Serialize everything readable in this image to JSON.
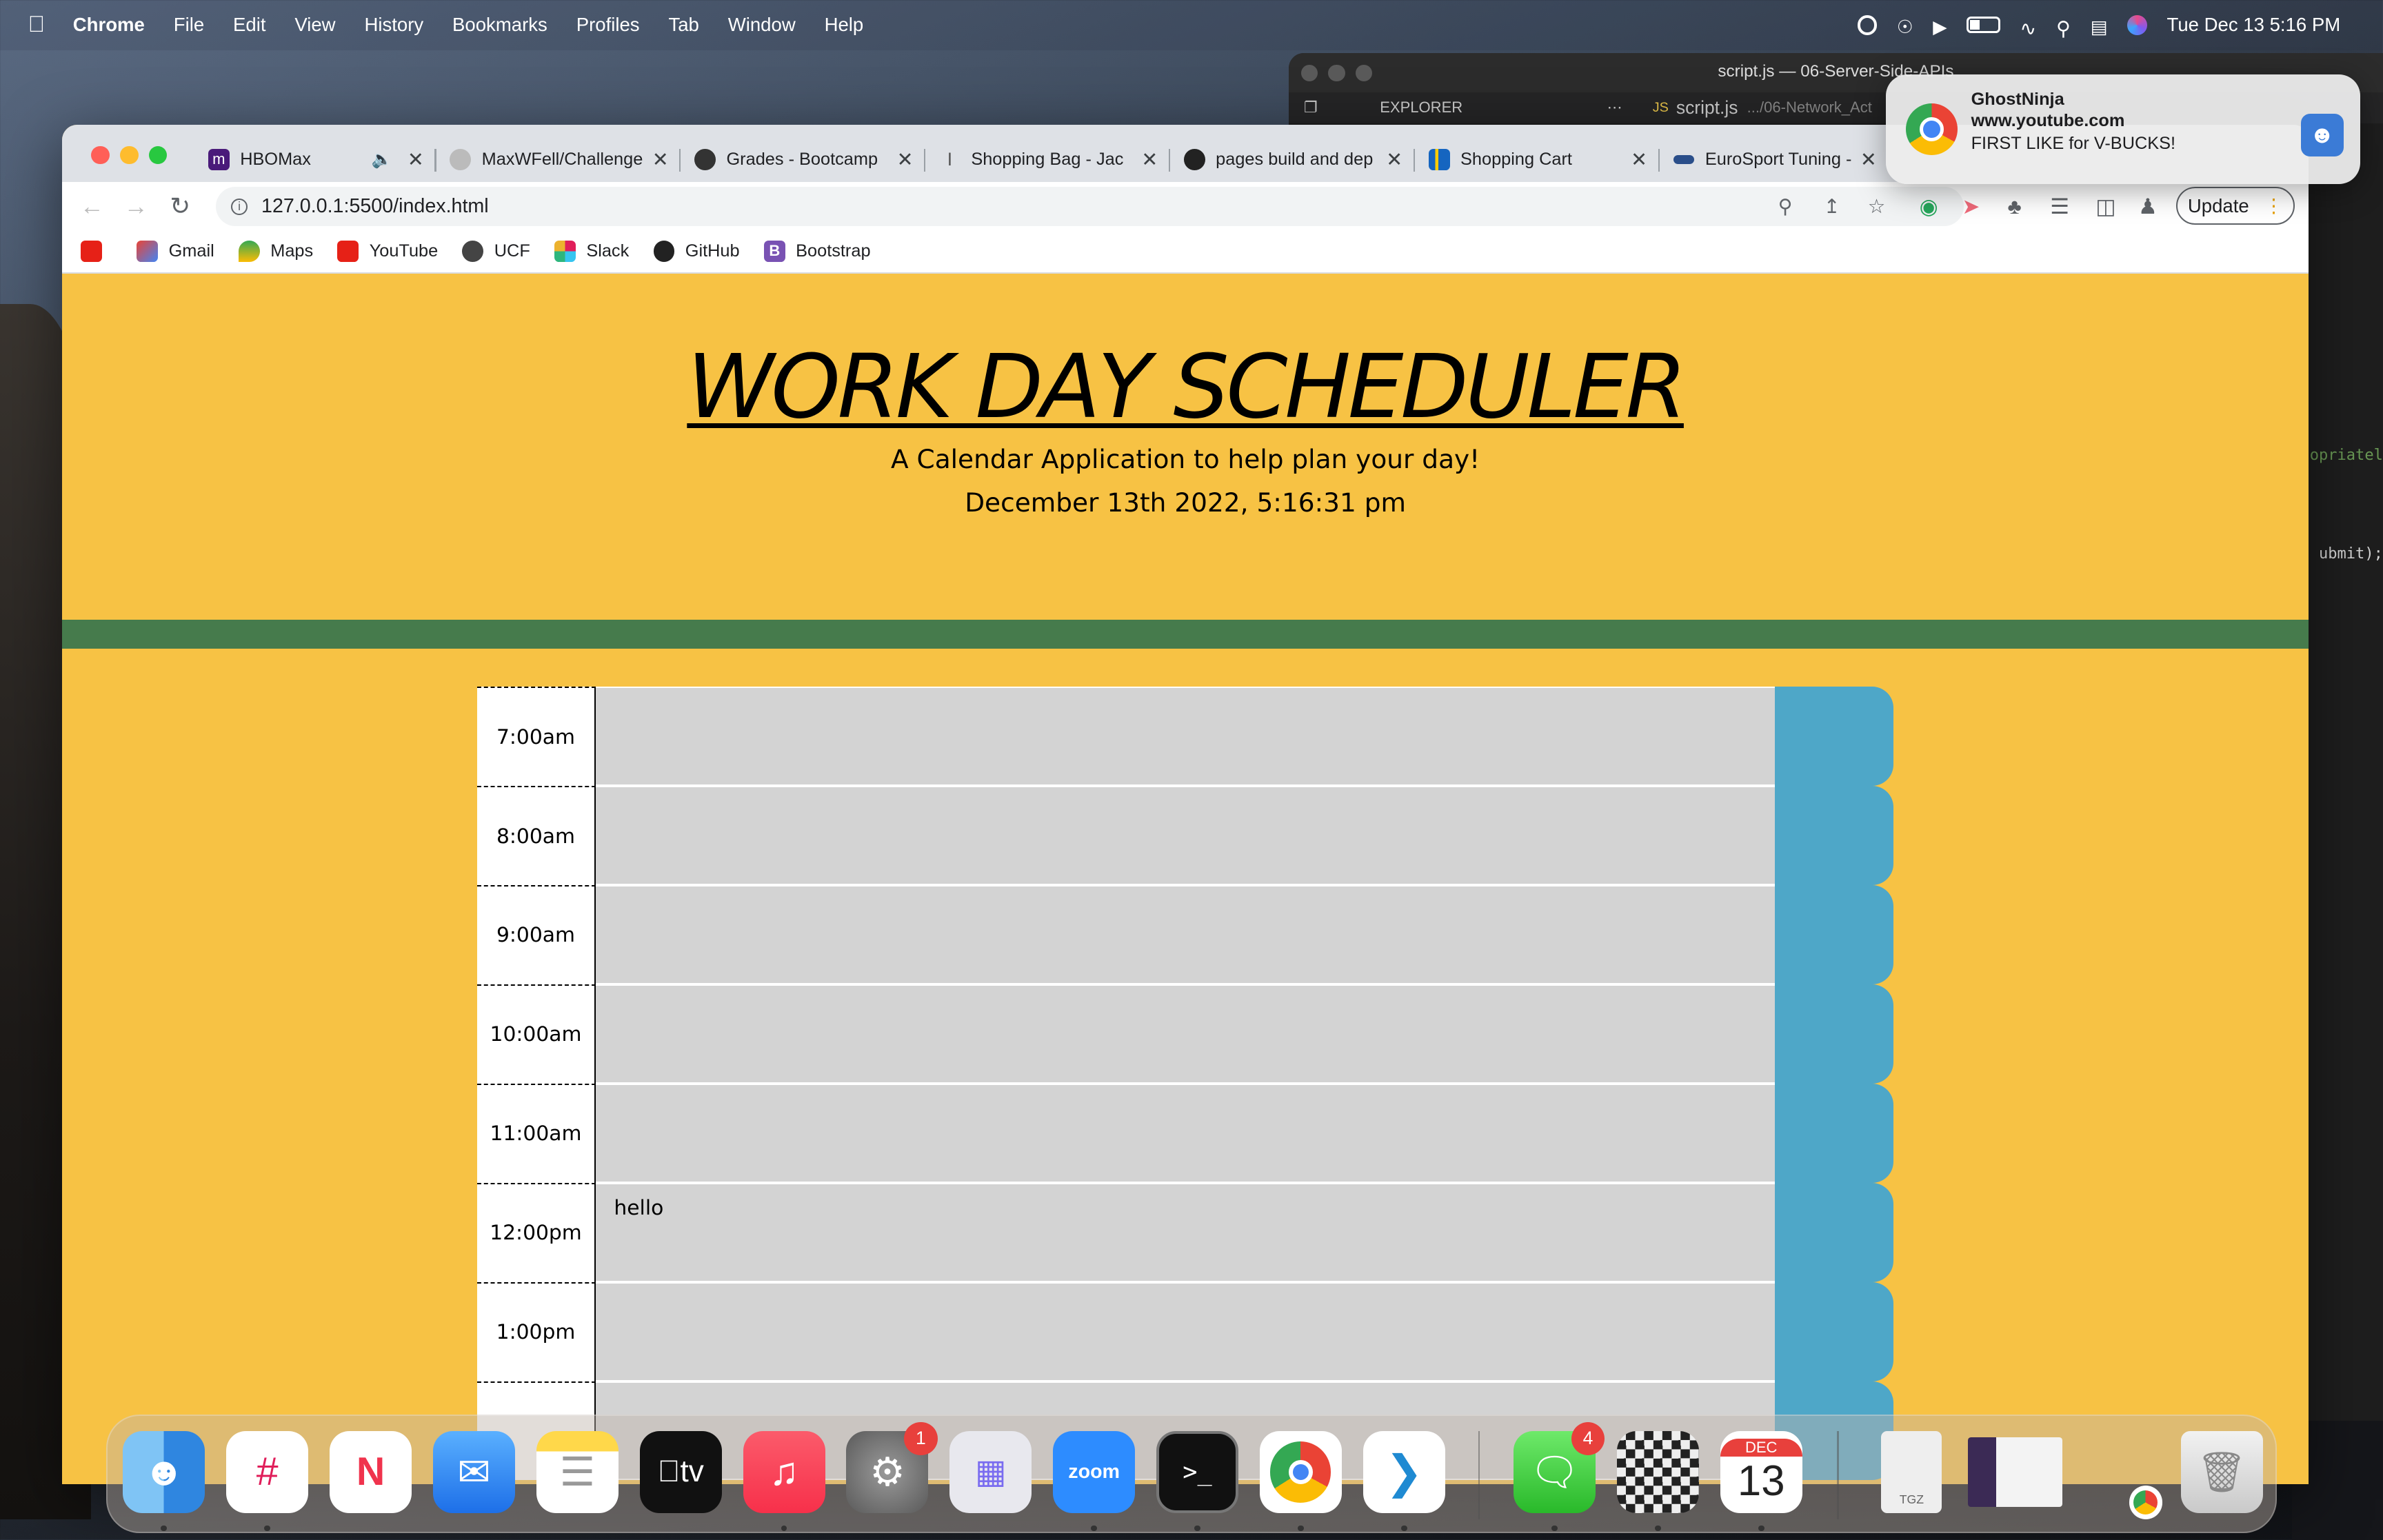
{
  "menubar": {
    "app": "Chrome",
    "items": [
      "File",
      "Edit",
      "View",
      "History",
      "Bookmarks",
      "Profiles",
      "Tab",
      "Window",
      "Help"
    ],
    "clock": "Tue Dec 13  5:16 PM"
  },
  "vscode": {
    "title": "script.js — 06-Server-Side-APIs",
    "explorer": "EXPLORER",
    "tab": "script.js",
    "tab_path": ".../06-Network_Act",
    "code1": "opriatel",
    "code2": "ubmit);"
  },
  "notification": {
    "app": "GhostNinja",
    "site": "www.youtube.com",
    "message": "FIRST LIKE for V-BUCKS!"
  },
  "tabs": [
    {
      "label": "HBOMax",
      "color": "#4a1a7a"
    },
    {
      "label": "MaxWFell/Challenge",
      "color": "#aaa"
    },
    {
      "label": "Grades - Bootcamp",
      "color": "#333"
    },
    {
      "label": "Shopping Bag - Jac",
      "color": "#777"
    },
    {
      "label": "pages build and dep",
      "color": "#222"
    },
    {
      "label": "Shopping Cart",
      "color": "#1565c0"
    },
    {
      "label": "EuroSport Tuning -",
      "color": "#2a4e8a"
    }
  ],
  "address": "127.0.0.1:5500/index.html",
  "update_label": "Update",
  "bookmarks": [
    {
      "label": "",
      "color": "#e62117"
    },
    {
      "label": "Gmail",
      "color": "#ea4335"
    },
    {
      "label": "Maps",
      "color": "#34a853"
    },
    {
      "label": "YouTube",
      "color": "#e62117"
    },
    {
      "label": "UCF",
      "color": "#444"
    },
    {
      "label": "Slack",
      "color": "#e01e5a"
    },
    {
      "label": "GitHub",
      "color": "#222"
    },
    {
      "label": "Bootstrap",
      "color": "#7952b3"
    }
  ],
  "page": {
    "title": "WORK DAY SCHEDULER",
    "lead": "A Calendar Application to help plan your day!",
    "date": "December 13th 2022, 5:16:31 pm",
    "rows": [
      {
        "hour": "7:00am",
        "text": ""
      },
      {
        "hour": "8:00am",
        "text": ""
      },
      {
        "hour": "9:00am",
        "text": ""
      },
      {
        "hour": "10:00am",
        "text": ""
      },
      {
        "hour": "11:00am",
        "text": ""
      },
      {
        "hour": "12:00pm",
        "text": "hello"
      },
      {
        "hour": "1:00pm",
        "text": ""
      },
      {
        "hour": "",
        "text": ""
      }
    ]
  },
  "colors": {
    "page_bg": "#f7c244",
    "divider": "#467b4c",
    "past_block": "#d3d3d3",
    "save_button": "#4ea7c8"
  },
  "dock": {
    "apps": [
      "finder",
      "slack",
      "news",
      "mail",
      "notes",
      "apple-tv",
      "music",
      "system-settings",
      "launchpad",
      "zoom",
      "terminal",
      "chrome",
      "vscode",
      "messages",
      "chess",
      "calendar",
      "archive",
      "screenshot",
      "chrome-small",
      "trash"
    ],
    "settings_badge": "1",
    "messages_badge": "4",
    "calendar_month": "DEC",
    "calendar_day": "13",
    "zoom_label": "zoom",
    "tv_label": "tv",
    "archive_label": "TGZ"
  }
}
